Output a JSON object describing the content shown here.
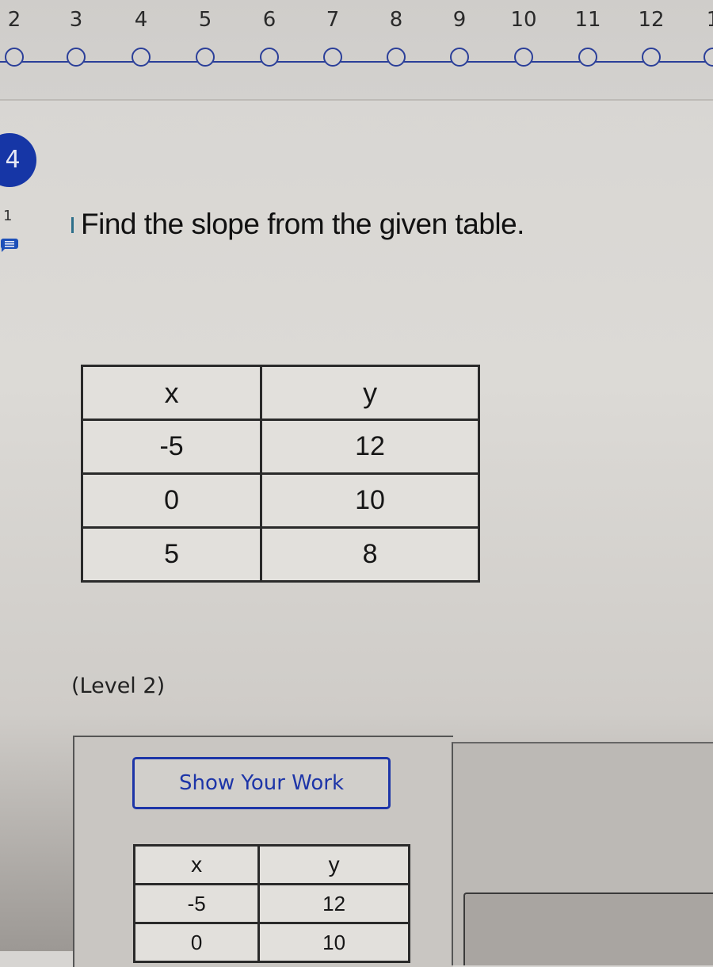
{
  "progress": {
    "steps": [
      "2",
      "3",
      "4",
      "5",
      "6",
      "7",
      "8",
      "9",
      "10",
      "11",
      "12",
      "1"
    ],
    "accent_color": "#2b3f99"
  },
  "question": {
    "number": "4",
    "points": "1",
    "comment_icon": "comment-icon",
    "prompt": "Find the slope from the given table.",
    "level": "(Level 2)",
    "badge_color": "#1636a6"
  },
  "table": {
    "headers": [
      "x",
      "y"
    ],
    "rows": [
      [
        "-5",
        "12"
      ],
      [
        "0",
        "10"
      ],
      [
        "5",
        "8"
      ]
    ]
  },
  "work_section": {
    "show_work_label": "Show Your Work",
    "button_color": "#1d35a8",
    "table": {
      "headers": [
        "x",
        "y"
      ],
      "rows": [
        [
          "-5",
          "12"
        ],
        [
          "0",
          "10"
        ]
      ]
    }
  }
}
